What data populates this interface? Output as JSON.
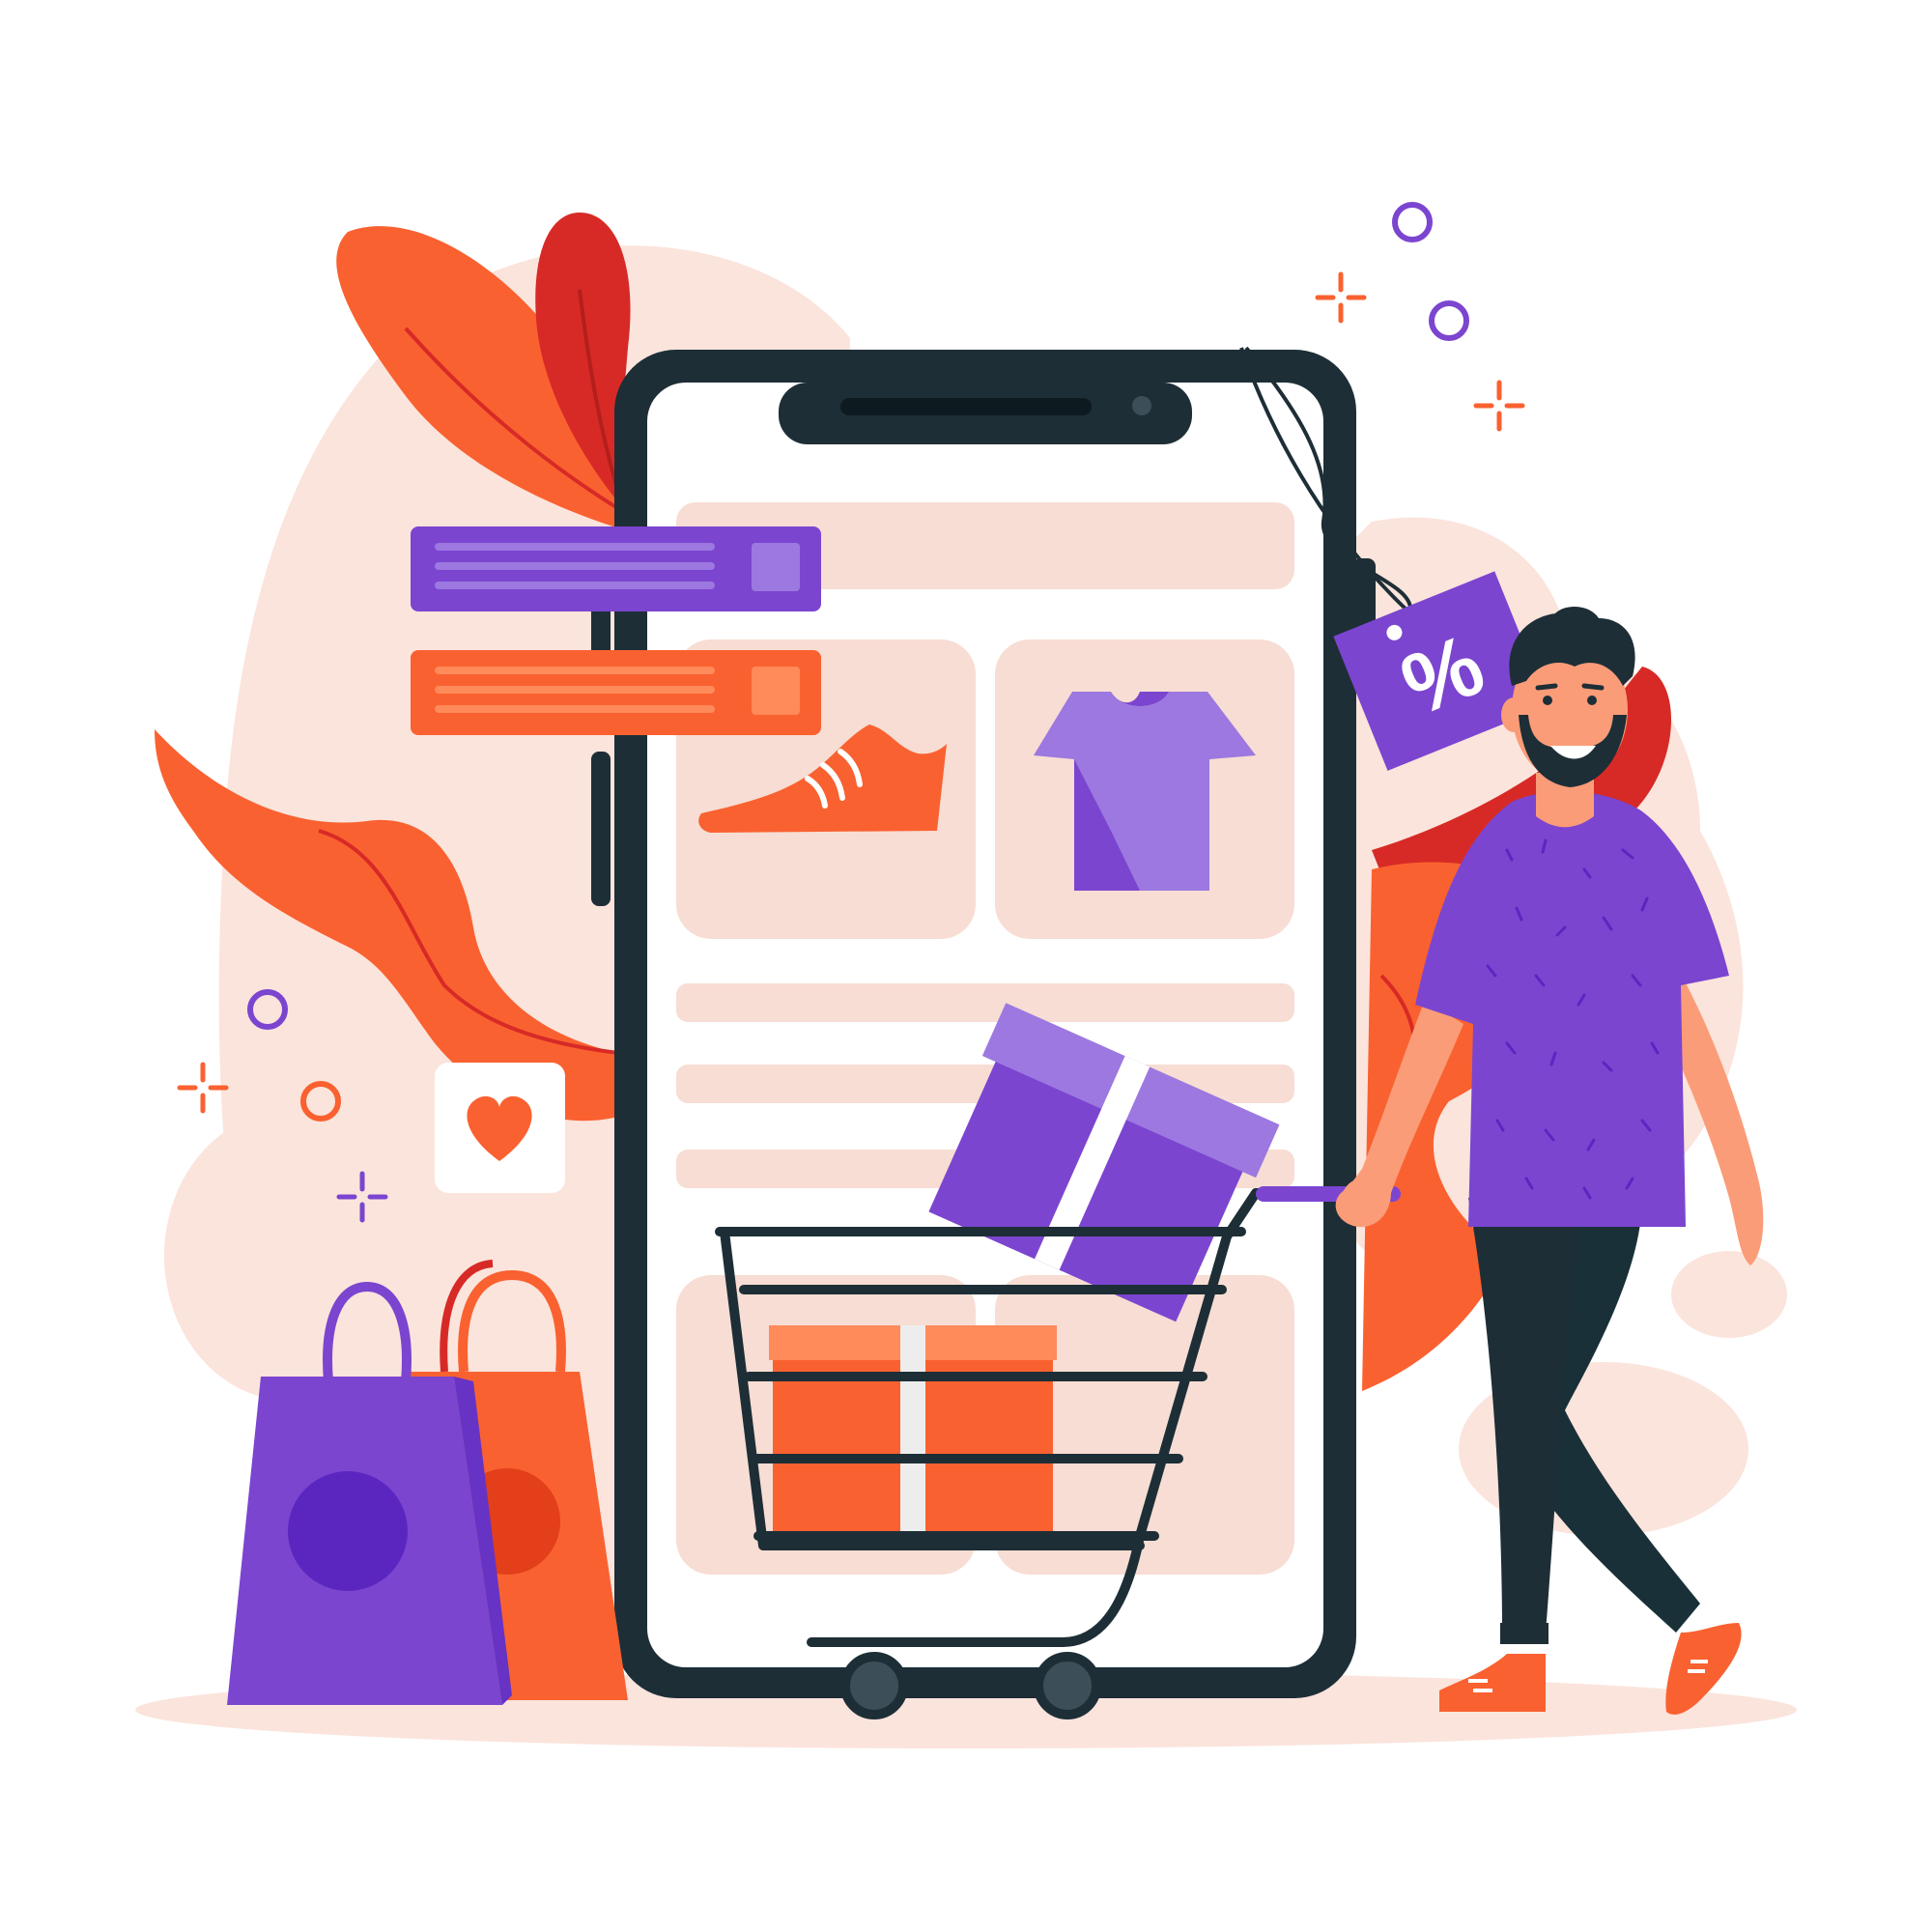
{
  "illustration": {
    "discount_tag_text": "%"
  },
  "colors": {
    "purple": "#7b45d0",
    "purple_light": "#9c78e0",
    "purple_dark": "#5b26c0",
    "orange": "#fa6130",
    "orange_light": "#ff8a5a",
    "red": "#d72a26",
    "peach_blob": "#fbe4dc",
    "phone_frame": "#1d2e36",
    "screen_placeholder": "#f7ddd3",
    "skin": "#fb9c78"
  },
  "icons": [
    "shoe-icon",
    "tshirt-icon",
    "heart-icon",
    "percent-tag-icon",
    "shopping-cart-icon",
    "gift-box-icon",
    "shopping-bag-icon",
    "sparkle-icon",
    "circle-decoration-icon"
  ]
}
